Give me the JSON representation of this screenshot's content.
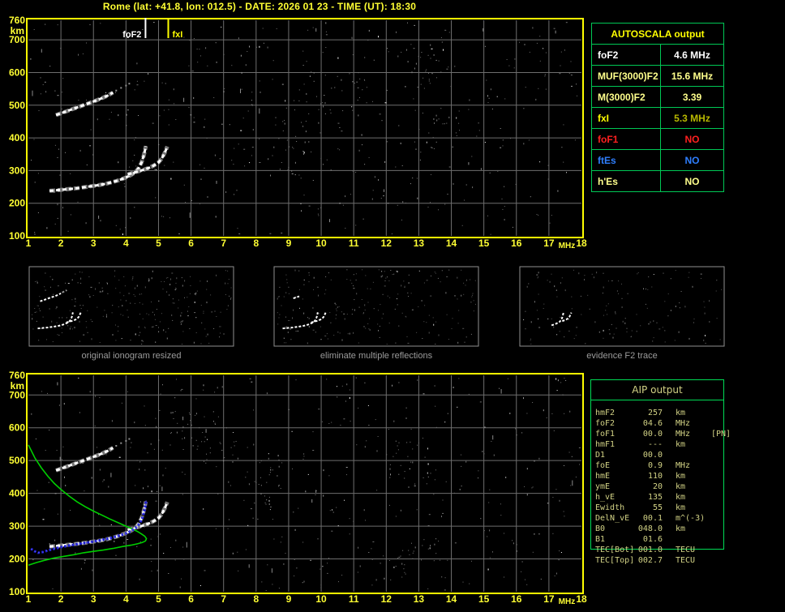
{
  "title": "Rome (lat: +41.8, lon: 012.5) - DATE: 2026 01 23 - TIME (UT): 18:30",
  "colors": {
    "background": "#000000",
    "axis_yellow": "#ffff33",
    "plot_border": "#ffff00",
    "grid_gray": "#6e6e6e",
    "table_border_green": "#00c855",
    "aip_text": "#d2d285",
    "caption_gray": "#9c9c9c",
    "thumb_border": "#8f8f8f",
    "trace_white": "#ffffff",
    "profile_green": "#00cf00",
    "fit_blue": "#1b1bcc"
  },
  "autoscala": {
    "header": "AUTOSCALA output",
    "rows": [
      {
        "label": "foF2",
        "value": "4.6 MHz",
        "label_color": "#ffffff",
        "value_color": "#ffffff"
      },
      {
        "label": "MUF(3000)F2",
        "value": "15.6 MHz",
        "label_color": "#ffff8c",
        "value_color": "#ffff8c"
      },
      {
        "label": "M(3000)F2",
        "value": "3.39",
        "label_color": "#ffff8c",
        "value_color": "#ffff8c"
      },
      {
        "label": "fxI",
        "value": "5.3 MHz",
        "label_color": "#ffff00",
        "value_color": "#b8b800"
      },
      {
        "label": "foF1",
        "value": "NO",
        "label_color": "#ff2020",
        "value_color": "#ff2020"
      },
      {
        "label": "ftEs",
        "value": "NO",
        "label_color": "#2f7fff",
        "value_color": "#2f7fff"
      },
      {
        "label": "h'Es",
        "value": "NO",
        "label_color": "#ffff8c",
        "value_color": "#ffff8c"
      }
    ]
  },
  "aip": {
    "header": "AIP output",
    "rows": [
      {
        "label": "hmF2",
        "value": "257",
        "unit": "km",
        "extra": ""
      },
      {
        "label": "foF2",
        "value": "04.6",
        "unit": "MHz",
        "extra": ""
      },
      {
        "label": "foF1",
        "value": "00.0",
        "unit": "MHz",
        "extra": "[PN]"
      },
      {
        "label": "hmF1",
        "value": "---",
        "unit": "km",
        "extra": ""
      },
      {
        "label": "D1",
        "value": "00.0",
        "unit": "",
        "extra": ""
      },
      {
        "label": "foE",
        "value": "0.9",
        "unit": "MHz",
        "extra": ""
      },
      {
        "label": "hmE",
        "value": "110",
        "unit": "km",
        "extra": ""
      },
      {
        "label": "ymE",
        "value": "20",
        "unit": "km",
        "extra": ""
      },
      {
        "label": "h_vE",
        "value": "135",
        "unit": "km",
        "extra": ""
      },
      {
        "label": "Ewidth",
        "value": "55",
        "unit": "km",
        "extra": ""
      },
      {
        "label": "DelN_vE",
        "value": "00.1",
        "unit": "m^(-3)",
        "extra": ""
      },
      {
        "label": "B0",
        "value": "048.0",
        "unit": "km",
        "extra": ""
      },
      {
        "label": "B1",
        "value": "01.6",
        "unit": "",
        "extra": ""
      },
      {
        "label": "TEC[Bot]",
        "value": "001.0",
        "unit": "TECU",
        "extra": ""
      },
      {
        "label": "TEC[Top]",
        "value": "002.7",
        "unit": "TECU",
        "extra": ""
      }
    ]
  },
  "thumbnails": [
    {
      "caption": "original ionogram resized",
      "series": [
        {
          "name": "F2-ordinary"
        },
        {
          "name": "F2-extraordinary"
        },
        {
          "name": "second-hop"
        },
        {
          "name": "second-hop-tail"
        }
      ]
    },
    {
      "caption": "eliminate multiple reflections",
      "series": [
        {
          "name": "F2-ordinary"
        },
        {
          "name": "F2-extraordinary"
        },
        {
          "name": "second-hop",
          "min_x": 2.4,
          "max_x": 3.2
        }
      ]
    },
    {
      "caption": "evidence F2 trace",
      "series": [
        {
          "name": "F2-ordinary",
          "min_x": 3.55
        },
        {
          "name": "F2-extraordinary",
          "min_x": 4.4
        }
      ]
    }
  ],
  "chart_data": [
    {
      "type": "scatter",
      "title": "ionogram with AUTOSCALA markers",
      "xlabel": "MHz",
      "ylabel": "km",
      "xlim": [
        1,
        18
      ],
      "ylim": [
        100,
        760
      ],
      "xticks": [
        1,
        2,
        3,
        4,
        5,
        6,
        7,
        8,
        9,
        10,
        11,
        12,
        13,
        14,
        15,
        16,
        17,
        18
      ],
      "yticks": [
        760,
        700,
        600,
        500,
        400,
        300,
        200,
        100
      ],
      "grid": true,
      "legend": "none",
      "markers": [
        {
          "label": "foF2",
          "x": 4.6,
          "color": "#ffffff",
          "side": "left"
        },
        {
          "label": "fxI",
          "x": 5.3,
          "color": "#ffff00",
          "side": "right"
        }
      ],
      "series": [
        {
          "name": "F2-ordinary",
          "color": "#ffffff",
          "style": "band",
          "points": [
            [
              1.65,
              238
            ],
            [
              1.8,
              239
            ],
            [
              2,
              241
            ],
            [
              2.2,
              243
            ],
            [
              2.5,
              246
            ],
            [
              2.8,
              250
            ],
            [
              3,
              253
            ],
            [
              3.2,
              256
            ],
            [
              3.4,
              260
            ],
            [
              3.6,
              265
            ],
            [
              3.8,
              271
            ],
            [
              4,
              279
            ],
            [
              4.15,
              286
            ],
            [
              4.3,
              296
            ],
            [
              4.4,
              309
            ],
            [
              4.48,
              325
            ],
            [
              4.54,
              344
            ],
            [
              4.58,
              360
            ],
            [
              4.61,
              375
            ]
          ]
        },
        {
          "name": "F2-extraordinary",
          "color": "#ffffff",
          "style": "band",
          "points": [
            [
              4.05,
              288
            ],
            [
              4.25,
              294
            ],
            [
              4.5,
              301
            ],
            [
              4.7,
              308
            ],
            [
              4.85,
              315
            ],
            [
              5,
              325
            ],
            [
              5.1,
              337
            ],
            [
              5.18,
              352
            ],
            [
              5.24,
              366
            ],
            [
              5.27,
              374
            ]
          ]
        },
        {
          "name": "second-hop",
          "color": "#ffffff",
          "style": "band",
          "points": [
            [
              1.85,
              470
            ],
            [
              2.05,
              477
            ],
            [
              2.3,
              486
            ],
            [
              2.55,
              495
            ],
            [
              2.8,
              504
            ],
            [
              3.05,
              513
            ],
            [
              3.25,
              521
            ],
            [
              3.45,
              530
            ],
            [
              3.6,
              539
            ]
          ]
        },
        {
          "name": "second-hop-tail",
          "color": "#909090",
          "style": "dots",
          "points": [
            [
              3.7,
              545
            ],
            [
              3.85,
              553
            ],
            [
              4,
              560
            ],
            [
              4.1,
              566
            ]
          ]
        }
      ]
    },
    {
      "type": "scatter",
      "title": "ionogram with restored profile (AIP)",
      "xlabel": "MHz",
      "ylabel": "km",
      "xlim": [
        1,
        18
      ],
      "ylim": [
        100,
        760
      ],
      "xticks": [
        1,
        2,
        3,
        4,
        5,
        6,
        7,
        8,
        9,
        10,
        11,
        12,
        13,
        14,
        15,
        16,
        17,
        18
      ],
      "yticks": [
        760,
        700,
        600,
        500,
        400,
        300,
        200,
        100
      ],
      "grid": true,
      "legend": "none",
      "markers": [],
      "series": [
        {
          "name": "F2-ordinary",
          "color": "#ffffff",
          "style": "band",
          "points": [
            [
              1.65,
              238
            ],
            [
              1.8,
              239
            ],
            [
              2,
              241
            ],
            [
              2.2,
              243
            ],
            [
              2.5,
              246
            ],
            [
              2.8,
              250
            ],
            [
              3,
              253
            ],
            [
              3.2,
              256
            ],
            [
              3.4,
              260
            ],
            [
              3.6,
              265
            ],
            [
              3.8,
              271
            ],
            [
              4,
              279
            ],
            [
              4.15,
              286
            ],
            [
              4.3,
              296
            ],
            [
              4.4,
              309
            ],
            [
              4.48,
              325
            ],
            [
              4.54,
              344
            ],
            [
              4.58,
              360
            ],
            [
              4.61,
              375
            ]
          ]
        },
        {
          "name": "F2-extraordinary",
          "color": "#ffffff",
          "style": "band",
          "points": [
            [
              4.05,
              288
            ],
            [
              4.25,
              294
            ],
            [
              4.5,
              301
            ],
            [
              4.7,
              308
            ],
            [
              4.85,
              315
            ],
            [
              5,
              325
            ],
            [
              5.1,
              337
            ],
            [
              5.18,
              352
            ],
            [
              5.24,
              366
            ],
            [
              5.27,
              374
            ]
          ]
        },
        {
          "name": "second-hop",
          "color": "#ffffff",
          "style": "band",
          "points": [
            [
              1.85,
              470
            ],
            [
              2.05,
              477
            ],
            [
              2.3,
              486
            ],
            [
              2.55,
              495
            ],
            [
              2.8,
              504
            ],
            [
              3.05,
              513
            ],
            [
              3.25,
              521
            ],
            [
              3.45,
              530
            ],
            [
              3.6,
              539
            ]
          ]
        },
        {
          "name": "second-hop-tail",
          "color": "#909090",
          "style": "dots",
          "points": [
            [
              3.7,
              545
            ],
            [
              3.85,
              553
            ],
            [
              4,
              560
            ],
            [
              4.1,
              566
            ]
          ]
        },
        {
          "name": "electron-density-profile",
          "color": "#00cf00",
          "style": "line",
          "points": [
            [
              1,
              548
            ],
            [
              1.2,
              508
            ],
            [
              1.4,
              478
            ],
            [
              1.6,
              452
            ],
            [
              1.8,
              430
            ],
            [
              2,
              412
            ],
            [
              2.25,
              392
            ],
            [
              2.5,
              374
            ],
            [
              2.75,
              359
            ],
            [
              3,
              346
            ],
            [
              3.25,
              334
            ],
            [
              3.5,
              322
            ],
            [
              3.75,
              311
            ],
            [
              4,
              300
            ],
            [
              4.2,
              291
            ],
            [
              4.35,
              284
            ],
            [
              4.48,
              276
            ],
            [
              4.58,
              269
            ],
            [
              4.63,
              262
            ],
            [
              4.6,
              255
            ],
            [
              4.5,
              250
            ],
            [
              4.35,
              246
            ],
            [
              4.15,
              242
            ],
            [
              3.9,
              238
            ],
            [
              3.6,
              232
            ],
            [
              3.3,
              227
            ],
            [
              3,
              223
            ],
            [
              2.7,
              219
            ],
            [
              2.4,
              213
            ],
            [
              2.1,
              208
            ],
            [
              1.8,
              203
            ],
            [
              1.5,
              196
            ],
            [
              1.25,
              189
            ],
            [
              1,
              181
            ]
          ]
        },
        {
          "name": "autoscala-fitted-trace",
          "color": "#1b1bcc",
          "style": "fit",
          "points": [
            [
              1.08,
              231
            ],
            [
              1.18,
              224
            ],
            [
              1.3,
              219
            ],
            [
              1.45,
              221
            ],
            [
              1.6,
              226
            ],
            [
              1.8,
              231
            ],
            [
              2,
              236
            ],
            [
              2.25,
              241
            ],
            [
              2.5,
              245
            ],
            [
              2.75,
              249
            ],
            [
              3,
              253
            ],
            [
              3.25,
              258
            ],
            [
              3.5,
              263
            ],
            [
              3.75,
              270
            ],
            [
              4,
              278
            ],
            [
              4.15,
              285
            ],
            [
              4.3,
              295
            ],
            [
              4.42,
              308
            ],
            [
              4.5,
              324
            ],
            [
              4.56,
              344
            ],
            [
              4.6,
              363
            ],
            [
              4.62,
              378
            ]
          ]
        }
      ]
    }
  ]
}
